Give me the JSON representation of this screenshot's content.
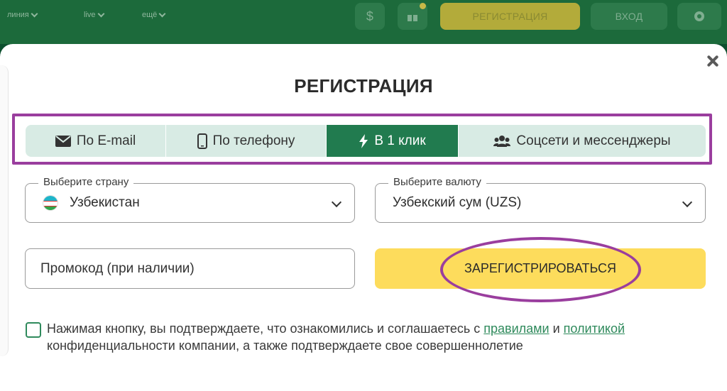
{
  "topbar": {
    "nav_items": [
      "линия",
      "LIVE",
      "ещё"
    ],
    "register_label": "РЕГИСТРАЦИЯ",
    "login_label": "ВХОД"
  },
  "modal": {
    "title": "РЕГИСТРАЦИЯ",
    "tabs": [
      {
        "label": "По E-mail",
        "icon": "envelope-icon"
      },
      {
        "label": "По телефону",
        "icon": "phone-icon"
      },
      {
        "label": "В 1 клик",
        "icon": "lightning-icon",
        "active": true
      },
      {
        "label": "Соцсети и мессенджеры",
        "icon": "users-icon"
      }
    ],
    "country": {
      "legend": "Выберите страну",
      "value": "Узбекистан",
      "flag": "uzbekistan-flag"
    },
    "currency": {
      "legend": "Выберите валюту",
      "value": "Узбекский сум (UZS)"
    },
    "promo": {
      "placeholder": "Промокод (при наличии)"
    },
    "register_button": "ЗАРЕГИСТРИРОВАТЬСЯ",
    "consent": {
      "text_before": "Нажимая кнопку, вы подтверждаете, что ознакомились и соглашаетесь с ",
      "rules_link": "правилами",
      "and": " и ",
      "policy_link": "политикой",
      "text_after": " конфиденциальности компании, а также подтверждаете свое совершеннолетие"
    }
  },
  "colors": {
    "active_tab": "#217b4f",
    "tab_bg": "#d8ebe4",
    "register_button": "#fddc5c",
    "highlight": "#9a3e9e",
    "link": "#2f8a5c"
  }
}
